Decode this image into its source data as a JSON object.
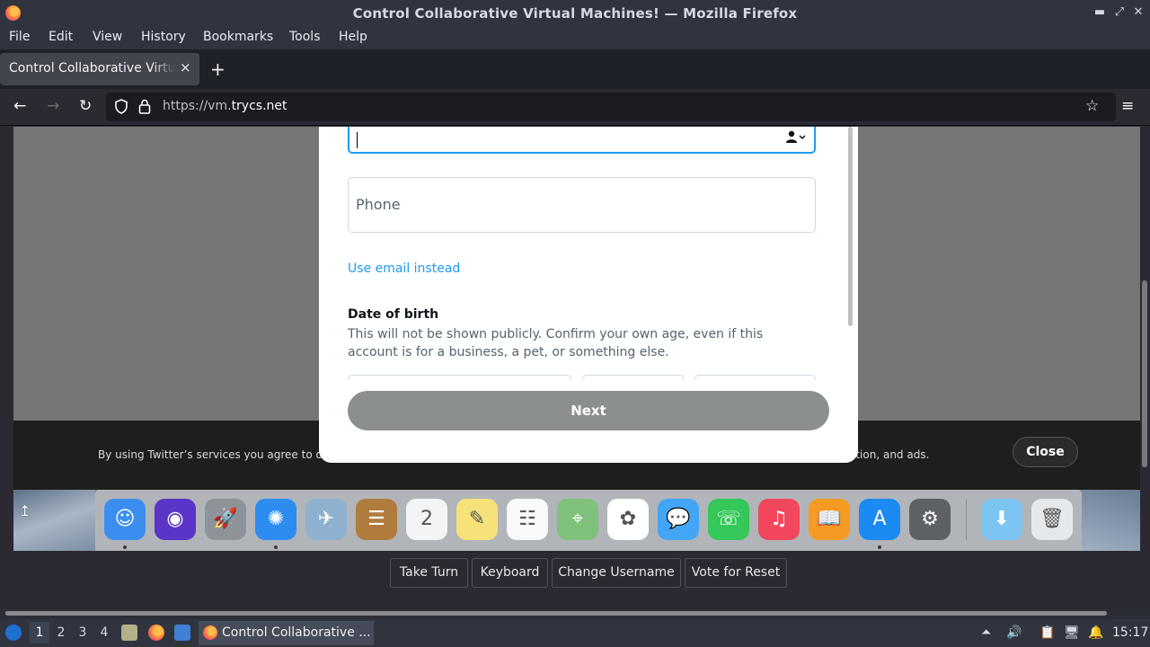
{
  "window": {
    "title": "Control Collaborative Virtual Machines! — Mozilla Firefox",
    "min_glyph": "▬",
    "max_glyph": "⤢",
    "close_glyph": "✕"
  },
  "menu": [
    "File",
    "Edit",
    "View",
    "History",
    "Bookmarks",
    "Tools",
    "Help"
  ],
  "tab": {
    "label": "Control Collaborative Virtual Machines!",
    "close_glyph": "×",
    "new_tab_glyph": "+"
  },
  "nav": {
    "back_glyph": "←",
    "forward_glyph": "→",
    "reload_glyph": "↻",
    "url_prefix": "https://vm.",
    "url_domain": "trycs.net",
    "bookmark_glyph": "☆",
    "menu_glyph": "≡"
  },
  "signup": {
    "name_value": "",
    "phone_placeholder": "Phone",
    "email_link": "Use email instead",
    "dob_title": "Date of birth",
    "dob_desc": "This will not be shown publicly. Confirm your own age, even if this account is for a business, a pet, or something else.",
    "next_label": "Next"
  },
  "cookie": {
    "text_start": "By using Twitter’s services you agree to ou",
    "text_end": "ation, and ads.",
    "close_label": "Close"
  },
  "dock": {
    "apps": [
      {
        "name": "finder-icon",
        "color": "#3b8ef0",
        "glyph": "☺"
      },
      {
        "name": "siri-icon",
        "color": "#5a35c7",
        "glyph": "◉"
      },
      {
        "name": "launchpad-icon",
        "color": "#8d9399",
        "glyph": "🚀"
      },
      {
        "name": "safari-icon",
        "color": "#2d8cf0",
        "glyph": "✺"
      },
      {
        "name": "preview-icon",
        "color": "#8fb1d0",
        "glyph": "✈"
      },
      {
        "name": "contacts-icon",
        "color": "#b07c3e",
        "glyph": "☰"
      },
      {
        "name": "calendar-icon",
        "color": "#f4f4f4",
        "glyph": "2"
      },
      {
        "name": "notes-icon",
        "color": "#f7e27a",
        "glyph": "✎"
      },
      {
        "name": "reminders-icon",
        "color": "#fafafa",
        "glyph": "☷"
      },
      {
        "name": "maps-icon",
        "color": "#7fc17b",
        "glyph": "⌖"
      },
      {
        "name": "photos-icon",
        "color": "#ffffff",
        "glyph": "✿"
      },
      {
        "name": "messages-icon",
        "color": "#42a5f5",
        "glyph": "💬"
      },
      {
        "name": "facetime-icon",
        "color": "#35c759",
        "glyph": "☏"
      },
      {
        "name": "music-icon",
        "color": "#f2475c",
        "glyph": "♫"
      },
      {
        "name": "books-icon",
        "color": "#f59a23",
        "glyph": "📖"
      },
      {
        "name": "appstore-icon",
        "color": "#1b8af2",
        "glyph": "A"
      },
      {
        "name": "system-preferences-icon",
        "color": "#5d6166",
        "glyph": "⚙"
      },
      {
        "name": "downloads-folder-icon",
        "color": "#7cc5f2",
        "glyph": "⬇"
      },
      {
        "name": "trash-icon",
        "color": "#e6e9ec",
        "glyph": "🗑"
      }
    ]
  },
  "vm_controls": [
    "Take Turn",
    "Keyboard",
    "Change Username",
    "Vote for Reset"
  ],
  "taskbar": {
    "workspaces": [
      "1",
      "2",
      "3",
      "4"
    ],
    "active_workspace": "1",
    "task_label": "Control Collaborative ...",
    "clock": "15:17"
  }
}
